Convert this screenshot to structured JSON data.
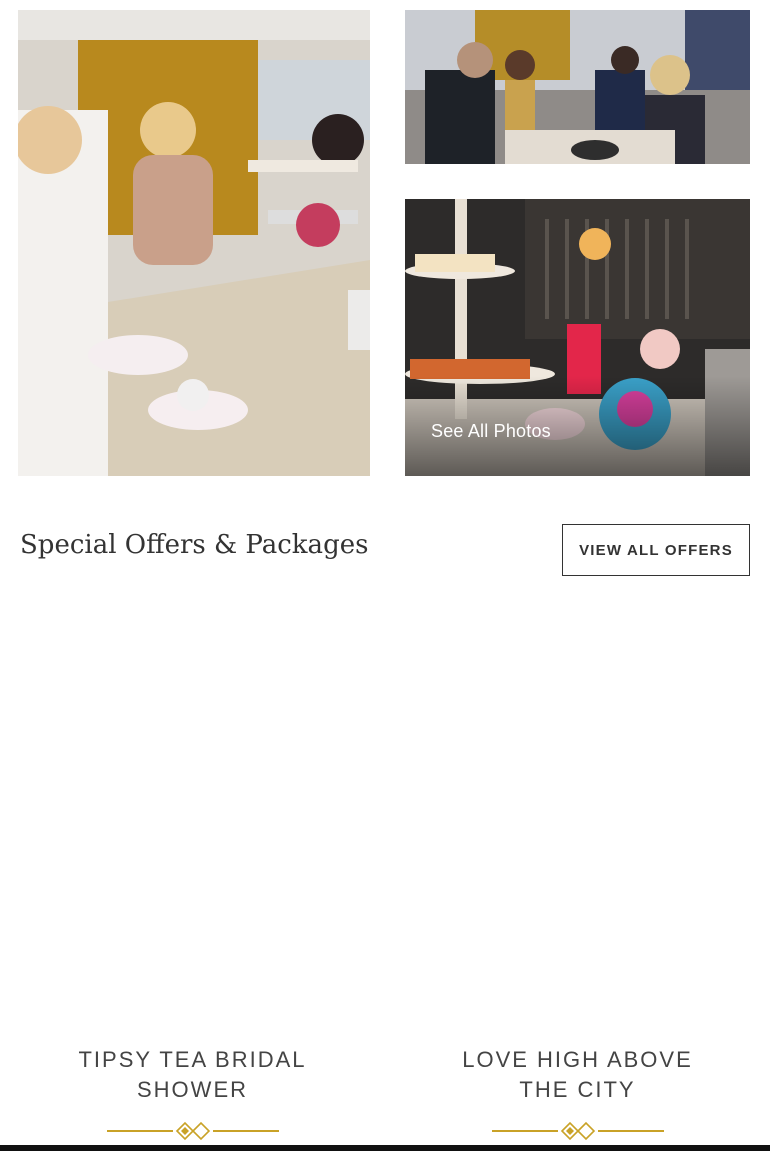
{
  "gallery": {
    "photos": [
      {
        "alt": "Guests enjoying afternoon tea service"
      },
      {
        "alt": "Diners at restaurant table"
      },
      {
        "alt": "Tiered tea stand with pastries and teapot"
      }
    ],
    "see_all_label": "See All Photos",
    "arrow_icon": "arrow-right-icon"
  },
  "offers_section": {
    "title": "Special Offers & Packages",
    "view_all_label": "VIEW ALL OFFERS"
  },
  "offers": [
    {
      "title": "TIPSY TEA BRIDAL SHOWER"
    },
    {
      "title": "LOVE HIGH ABOVE THE CITY"
    }
  ],
  "colors": {
    "accent_gold": "#c9a227",
    "text_dark": "#333333",
    "bottom_bar": "#111111"
  }
}
